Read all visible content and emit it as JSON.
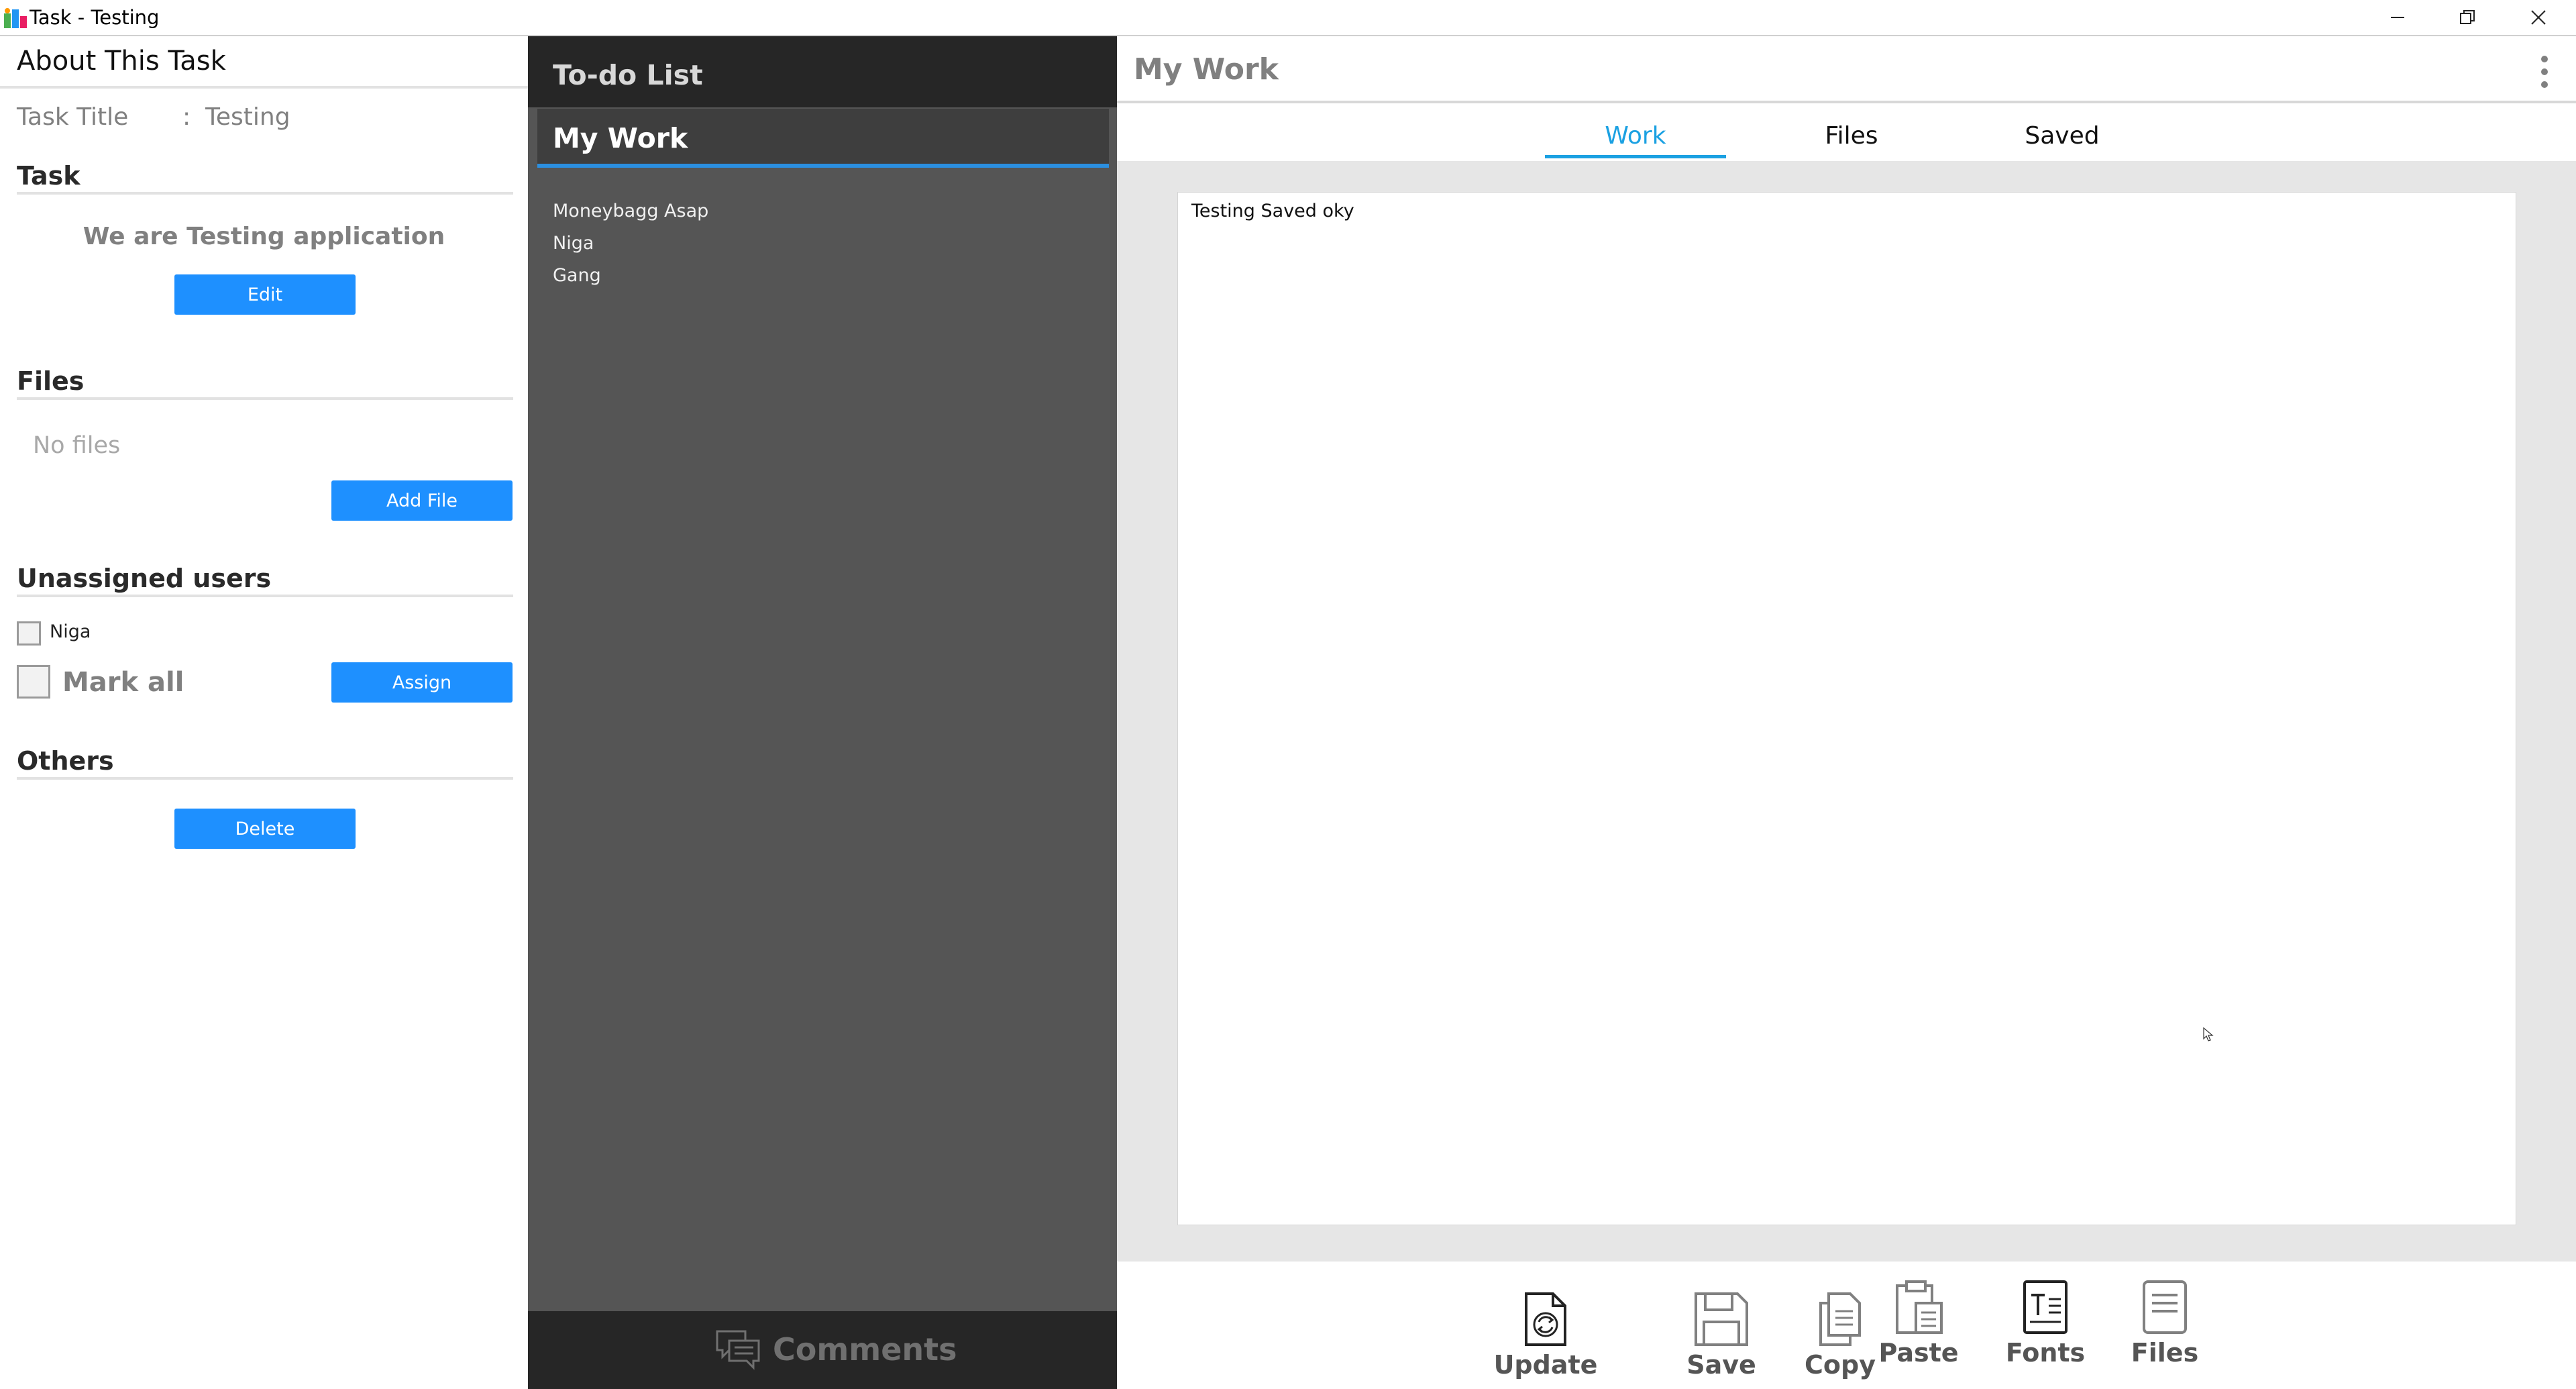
{
  "window": {
    "title": "Task - Testing"
  },
  "about": {
    "heading": "About This Task",
    "task_title_label": "Task Title",
    "task_title_sep": ":",
    "task_title_value": "Testing"
  },
  "task": {
    "heading": "Task",
    "description": "We are Testing application",
    "edit_label": "Edit"
  },
  "files": {
    "heading": "Files",
    "empty_text": "No files",
    "add_label": "Add File"
  },
  "users": {
    "heading": "Unassigned users",
    "items": [
      {
        "name": "Niga",
        "checked": false
      }
    ],
    "mark_all_label": "Mark all",
    "assign_label": "Assign"
  },
  "others": {
    "heading": "Others",
    "delete_label": "Delete"
  },
  "todo": {
    "heading": "To-do List",
    "active": "My Work",
    "items": [
      "Moneybagg Asap",
      "Niga",
      "Gang"
    ],
    "comments_label": "Comments"
  },
  "work": {
    "title": "My Work",
    "tabs": [
      "Work",
      "Files",
      "Saved"
    ],
    "active_tab": "Work",
    "editor_text": "Testing Saved oky"
  },
  "toolbar": {
    "update": "Update",
    "save": "Save",
    "copy": "Copy",
    "paste": "Paste",
    "fonts": "Fonts",
    "files": "Files"
  },
  "colors": {
    "accent": "#1e90ff",
    "tab_active": "#1ba1e2",
    "dark_panel": "#262626",
    "mid_panel": "#555555"
  }
}
